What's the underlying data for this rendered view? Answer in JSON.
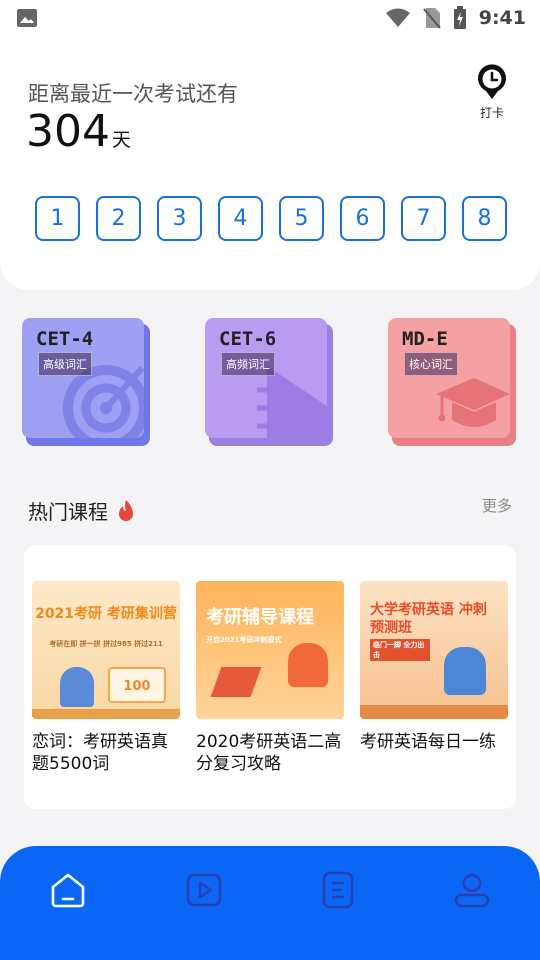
{
  "status_bar": {
    "time": "9:41",
    "icons": [
      "image-icon",
      "wifi-icon",
      "no-sim-icon",
      "battery-charging-icon"
    ]
  },
  "exam": {
    "label": "距离最近一次考试还有",
    "days": "304",
    "unit": "天"
  },
  "checkin": {
    "label": "打卡",
    "icon": "clock-pin-icon"
  },
  "number_buttons": [
    "1",
    "2",
    "3",
    "4",
    "5",
    "6",
    "7",
    "8"
  ],
  "books": [
    {
      "title": "CET-4",
      "subtitle": "高级词汇",
      "icon": "target-icon",
      "color": "#9da0f3"
    },
    {
      "title": "CET-6",
      "subtitle": "高频词汇",
      "icon": "notebook-pen-icon",
      "color": "#b89cf2"
    },
    {
      "title": "MD-E",
      "subtitle": "核心词汇",
      "icon": "graduation-cap-icon",
      "color": "#f5a0a3"
    }
  ],
  "hot_courses": {
    "title": "热门课程",
    "more": "更多",
    "items": [
      {
        "title": "恋词：考研英语真题5500词",
        "thumb_text": "2021考研 考研集训营",
        "thumb_sub": "考研在即 拼一拼 拼过985 拼过211",
        "thumb_badge": "100"
      },
      {
        "title": "2020考研英语二高分复习攻略",
        "thumb_text": "考研辅导课程",
        "thumb_sub": "开启2021考研冲刺模式"
      },
      {
        "title": "考研英语每日一练",
        "thumb_text": "大学考研英语 冲刺预测班",
        "thumb_sub": "临门一脚 全力出击"
      }
    ]
  },
  "bottom_nav": [
    {
      "name": "home",
      "icon": "home-icon",
      "active": true
    },
    {
      "name": "video",
      "icon": "play-icon",
      "active": false
    },
    {
      "name": "document",
      "icon": "document-icon",
      "active": false
    },
    {
      "name": "profile",
      "icon": "user-icon",
      "active": false
    }
  ]
}
